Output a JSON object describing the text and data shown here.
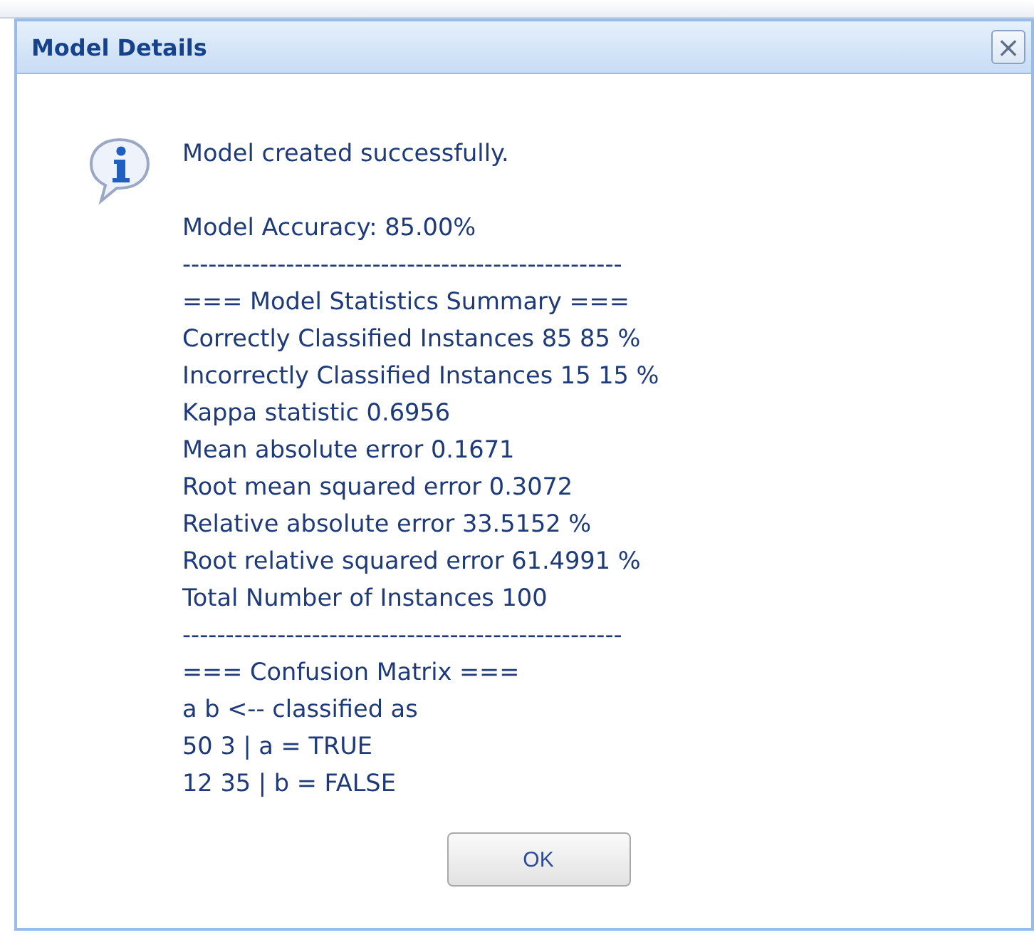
{
  "dialog": {
    "title": "Model Details",
    "close_label": "×",
    "message": "Model created successfully.",
    "report": [
      "Model Accuracy: 85.00%",
      "---------------------------------------------------",
      "=== Model Statistics Summary ===",
      "Correctly Classified Instances 85 85 %",
      "Incorrectly Classified Instances 15 15 %",
      "Kappa statistic 0.6956",
      "Mean absolute error 0.1671",
      "Root mean squared error 0.3072",
      "Relative absolute error 33.5152 %",
      "Root relative squared error 61.4991 %",
      "Total Number of Instances 100",
      "---------------------------------------------------",
      "=== Confusion Matrix ===",
      "a b <-- classified as",
      "50 3 | a = TRUE",
      "12 35 | b = FALSE"
    ],
    "buttons": [
      "OK"
    ]
  }
}
